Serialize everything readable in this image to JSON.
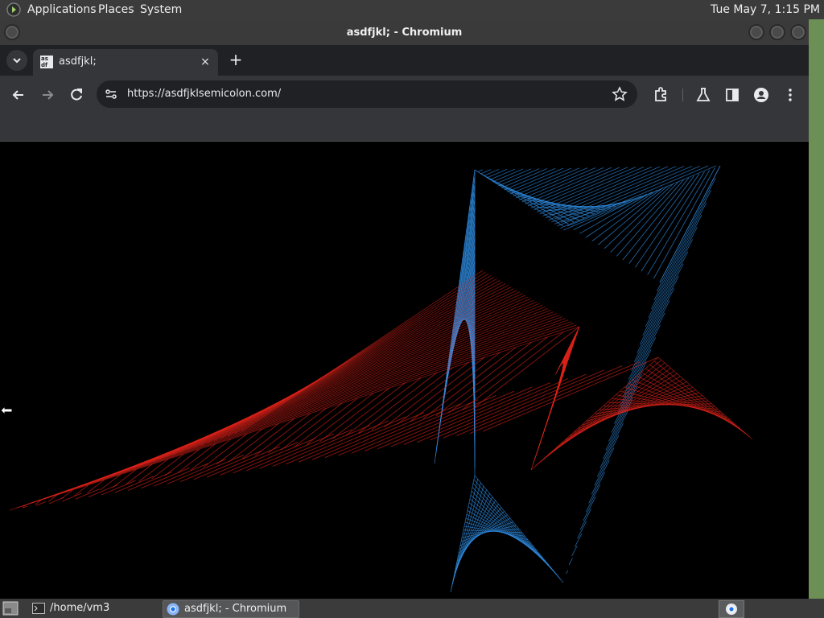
{
  "top_panel": {
    "menus": [
      "Applications",
      "Places",
      "System"
    ],
    "clock": "Tue May 7,  1:15 PM"
  },
  "window": {
    "title": "asdfjkl; - Chromium"
  },
  "browser": {
    "tab": {
      "favicon_text": "as\ndf",
      "title": "asdfjkl;",
      "close": "×"
    },
    "new_tab": "+",
    "url": "https://asdfjklsemicolon.com/"
  },
  "taskbar": {
    "items": [
      {
        "label": "/home/vm3",
        "icon": "terminal-icon"
      },
      {
        "label": "asdfjkl; - Chromium",
        "icon": "chromium-icon"
      }
    ]
  },
  "colors": {
    "red_lines": "#e0231a",
    "blue_lines": "#2f8fe6",
    "content_bg": "#000000"
  }
}
